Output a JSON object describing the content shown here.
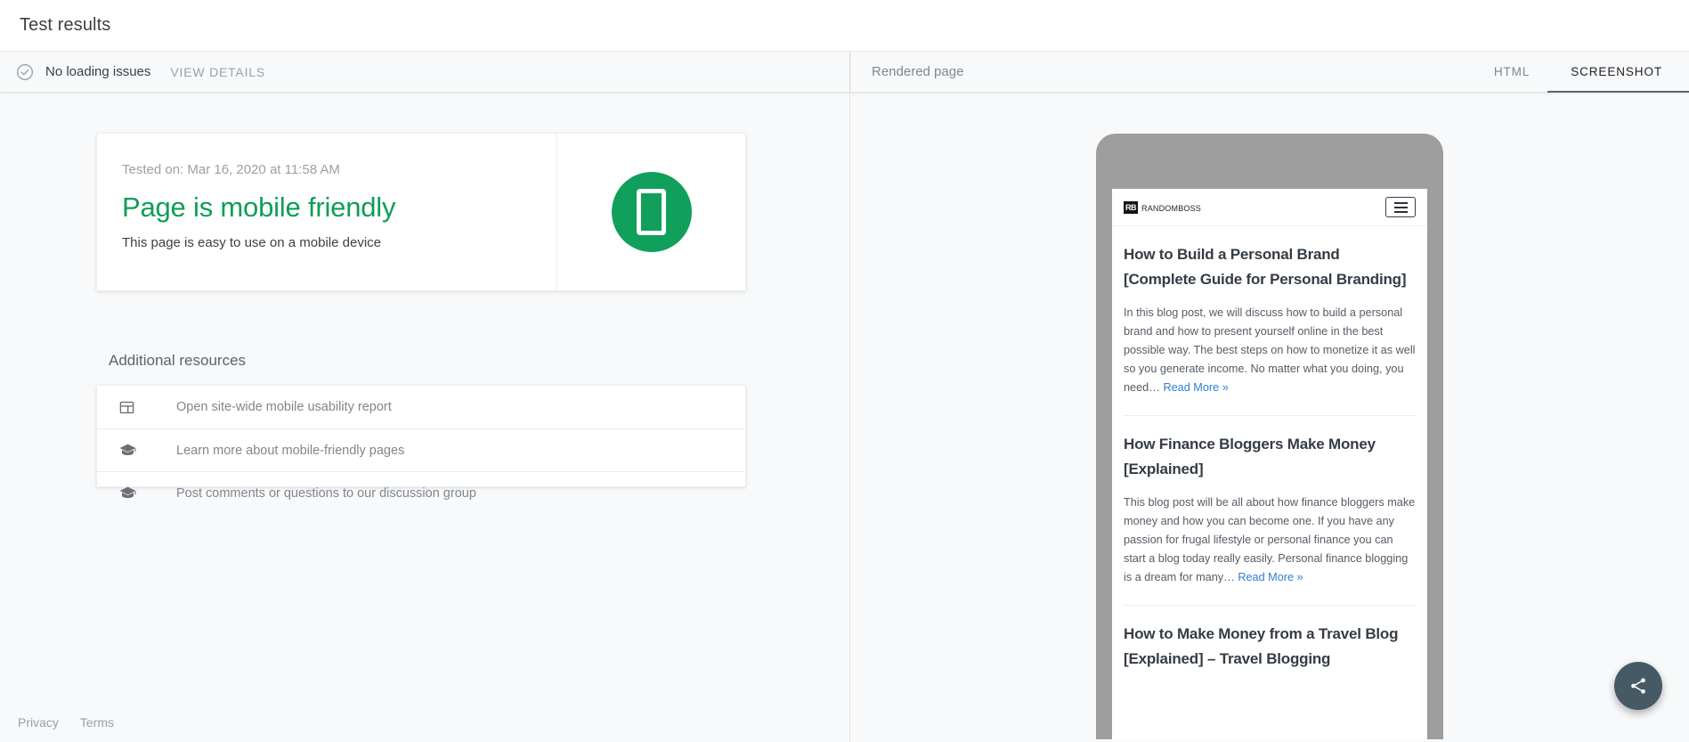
{
  "appbar": {
    "title": "Test results"
  },
  "status": {
    "check_icon": "check-circle-icon",
    "text": "No loading issues",
    "view_details_label": "VIEW DETAILS"
  },
  "result": {
    "tested_on": "Tested on: Mar 16, 2020 at 11:58 AM",
    "verdict": "Page is mobile friendly",
    "subtext": "This page is easy to use on a mobile device",
    "badge_icon": "mobile-phone-icon",
    "verdict_color": "#0f9d58",
    "badge_color": "#10a05c"
  },
  "resources": {
    "heading": "Additional resources",
    "items": [
      {
        "icon": "report-dashboard-icon",
        "label": "Open site-wide mobile usability report"
      },
      {
        "icon": "graduation-cap-icon",
        "label": "Learn more about mobile-friendly pages"
      },
      {
        "icon": "graduation-cap-icon",
        "label": "Post comments or questions to our discussion group"
      }
    ]
  },
  "footer": {
    "privacy": "Privacy",
    "terms": "Terms"
  },
  "rendered": {
    "label": "Rendered page",
    "tabs": [
      {
        "label": "HTML",
        "active": false
      },
      {
        "label": "SCREENSHOT",
        "active": true
      }
    ]
  },
  "preview": {
    "site": {
      "logo_mark": "RB",
      "logo_text": "RandomBoss",
      "menu_icon": "hamburger-menu-icon"
    },
    "posts": [
      {
        "title": "How to Build a Personal Brand [Complete Guide for Personal Branding]",
        "excerpt": "In this blog post, we will discuss how to build a personal brand and how to present yourself online in the best possible way. The best steps on how to monetize it as well so you generate income. No matter what you doing, you need… ",
        "read_more": "Read More »"
      },
      {
        "title": "How Finance Bloggers Make Money [Explained]",
        "excerpt": "This blog post will be all about how finance bloggers make money and how you can become one. If you have any passion for frugal lifestyle or personal finance you can start a blog today really easily. Personal finance blogging is a dream for many… ",
        "read_more": "Read More »"
      },
      {
        "title": "How to Make Money from a Travel Blog [Explained] – Travel Blogging",
        "excerpt": "",
        "read_more": ""
      }
    ]
  },
  "fab": {
    "icon": "share-icon",
    "color": "#455a64"
  }
}
